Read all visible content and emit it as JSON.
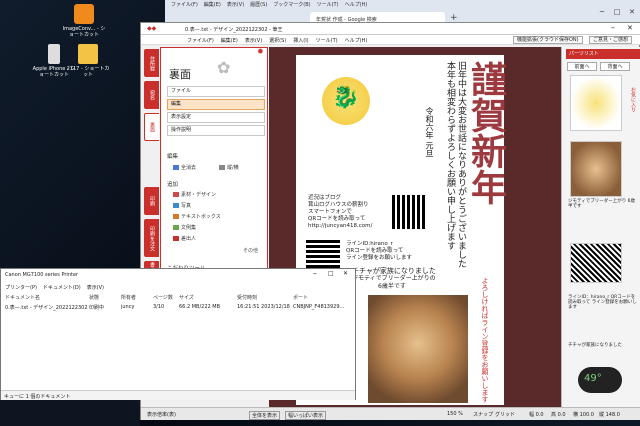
{
  "desktop": {
    "icons": [
      {
        "label": "ImageConv... - ショートカット",
        "icon": "orange-app-icon"
      },
      {
        "label": "Apple iPhone - ショートカット",
        "icon": "iphone-icon"
      },
      {
        "label": "2117 - ショートカット",
        "icon": "folder-icon"
      }
    ]
  },
  "browser": {
    "menu": [
      "ファイル(F)",
      "編集(E)",
      "表示(V)",
      "履歴(S)",
      "ブックマーク(B)",
      "ツール(T)",
      "ヘルプ(H)"
    ],
    "tab_label": "年賀状 作成 - Google 検索",
    "new_tab": "+"
  },
  "editor": {
    "title": "0.表—.txt - デザイン_2022122302 - 筆王",
    "menu": [
      "ファイル(F)",
      "編集(E)",
      "表示(V)",
      "選択(S)",
      "挿入(I)",
      "ツール(T)",
      "ヘルプ(H)"
    ],
    "right_buttons": [
      "機能拡張(クラウド保存ON)",
      "ご意見・ご感想"
    ],
    "ribbon_tabs": [
      "住所録",
      "宛名",
      "裏面",
      "印刷",
      "印刷を注文",
      "書き順機能"
    ],
    "side": {
      "header": "裏面",
      "menu": [
        "ファイル",
        "編集",
        "表示設定",
        "操作説明"
      ],
      "selected": "編集",
      "sections": {
        "edit": "編集",
        "add": "追加",
        "tools": "こだわりツール",
        "other": "その他"
      },
      "edit_items": [
        "全消去",
        "縦/横"
      ],
      "add_items": [
        "素材・デザイン",
        "写真",
        "テキストボックス",
        "文例集",
        "差出人"
      ]
    },
    "card": {
      "big": [
        "謹",
        "賀",
        "新",
        "年"
      ],
      "red_sub": "よろしければライン登録をお願いします",
      "greeting": [
        "旧年中は大変お世話になりありがとうございました",
        "本年も相変わらずよろしくお願い申し上げます"
      ],
      "date": "令和六年 元旦",
      "blog": [
        "近況はブログ",
        "茸山ログハウスの薪割り",
        "スマートフォンで",
        "QRコードを読み取って",
        "http://juncyan418.com/"
      ],
      "line": [
        "ラインID:hirano_r",
        "QRコードを読み取って",
        "ライン登録をお願いします"
      ],
      "dog": [
        "チチャが家族になりました",
        "ジモティでブリーダー上がりの",
        "6歳半です"
      ],
      "right_col": [
        "私事ですが今年",
        "会社を解雇されて",
        "今年の春頃から年金",
        "収入のみの生活になりました"
      ]
    },
    "parts": {
      "title": "パーツリスト",
      "tabs": [
        "前面へ",
        "背面へ"
      ],
      "captions": [
        "ジモティでブリーダー上がり 6歳半です",
        "ラインID：hirano_r QRコードを読み取って ライン登録をお願いします",
        "チチャが家族になりました"
      ],
      "side_label": "お気に入り"
    },
    "status": [
      "表示倍率(表)",
      "全体を表示",
      "幅いっぱい表示",
      "150 %",
      "スナップ",
      "グリッド",
      "幅 0.0",
      "高 0.0",
      "横 100.0",
      "縦 148.0"
    ]
  },
  "printer": {
    "title": "Canon MG7100 series Printer",
    "menu": [
      "プリンター(P)",
      "ドキュメント(D)",
      "表示(V)"
    ],
    "headers": [
      "ドキュメント名",
      "状態",
      "所有者",
      "ページ数",
      "サイズ",
      "受付時刻",
      "ポート"
    ],
    "rows": [
      {
        "name": "0.表—.txt - デザイン_2022122302",
        "status": "印刷中",
        "owner": "juncy",
        "pages": "3/10",
        "size": "66.2 MB/222 MB",
        "time": "16:21:51 2023/12/18",
        "port": "CNBJNP_F4813929..."
      }
    ],
    "footer": "キューに 1 個のドキュメント"
  },
  "weather": {
    "temp": "49°"
  },
  "colors": {
    "accent": "#c9302c",
    "big_text": "#9c3a3f"
  }
}
